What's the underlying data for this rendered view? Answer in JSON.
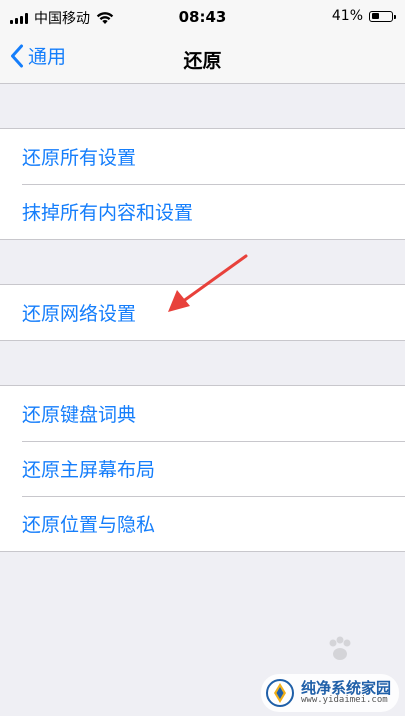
{
  "status_bar": {
    "carrier": "中国移动",
    "time": "08:43",
    "battery_percent": "41%",
    "battery_level": 0.41,
    "icons": [
      "signal-icon",
      "wifi-icon",
      "battery-icon"
    ]
  },
  "nav": {
    "back_label": "通用",
    "title": "还原"
  },
  "groups": [
    {
      "items": [
        "还原所有设置",
        "抹掉所有内容和设置"
      ]
    },
    {
      "items": [
        "还原网络设置"
      ]
    },
    {
      "items": [
        "还原键盘词典",
        "还原主屏幕布局",
        "还原位置与隐私"
      ]
    }
  ],
  "annotation": {
    "color": "#e8413b",
    "target": "还原网络设置"
  },
  "watermark": {
    "title": "纯净系统家园",
    "url": "www.yidaimei.com"
  },
  "colors": {
    "accent": "#157efb",
    "background": "#efeff4",
    "separator": "#c8c7cc"
  }
}
